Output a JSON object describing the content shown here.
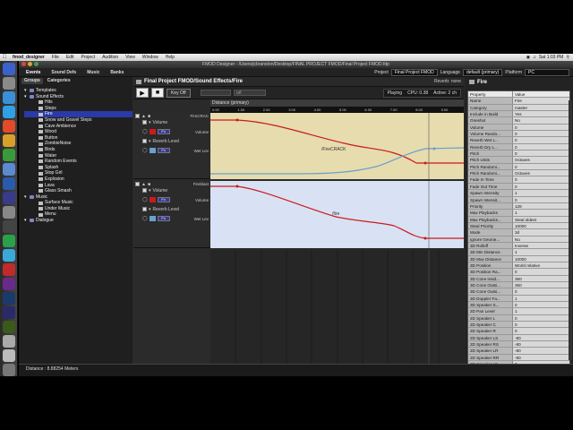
{
  "menubar": {
    "app": "fmod_designer",
    "items": [
      "File",
      "Edit",
      "Project",
      "Audition",
      "View",
      "Window",
      "Help"
    ],
    "clock": "Sat 1:03 PM"
  },
  "window": {
    "title": "FMOD Designer - /Users/jcbranston/Desktop/FINAL PROJECT FMOD/Final Project FMOD.fdp"
  },
  "toolbar": {
    "tabs": [
      "Events",
      "Sound Defs",
      "Music",
      "Banks"
    ],
    "project_label": "Project",
    "project_value": "Final Project FMOD",
    "language_label": "Language",
    "language_value": "default (primary)",
    "platform_label": "Platform",
    "platform_value": "PC"
  },
  "left": {
    "subtabs": [
      "Groups",
      "Categories"
    ],
    "tree": [
      {
        "label": "Templates",
        "type": "folder",
        "depth": 1
      },
      {
        "label": "Sound Effects",
        "type": "folder",
        "depth": 1
      },
      {
        "label": "Hits",
        "type": "event",
        "depth": 2
      },
      {
        "label": "Steps",
        "type": "event",
        "depth": 2
      },
      {
        "label": "Fire",
        "type": "event",
        "depth": 2,
        "selected": true
      },
      {
        "label": "Snow and Gravel Steps",
        "type": "event",
        "depth": 2
      },
      {
        "label": "Cave Ambience",
        "type": "event",
        "depth": 2
      },
      {
        "label": "Wood",
        "type": "event",
        "depth": 2
      },
      {
        "label": "Button",
        "type": "event",
        "depth": 2
      },
      {
        "label": "ZombieNoise",
        "type": "event",
        "depth": 2
      },
      {
        "label": "Birds",
        "type": "event",
        "depth": 2
      },
      {
        "label": "Water",
        "type": "event",
        "depth": 2
      },
      {
        "label": "Random Events",
        "type": "event",
        "depth": 2
      },
      {
        "label": "Splash",
        "type": "event",
        "depth": 2
      },
      {
        "label": "Stop Girl",
        "type": "event",
        "depth": 2
      },
      {
        "label": "Explosion",
        "type": "event",
        "depth": 2
      },
      {
        "label": "Lava",
        "type": "event",
        "depth": 2
      },
      {
        "label": "Glass Smash",
        "type": "event",
        "depth": 2
      },
      {
        "label": "Music",
        "type": "folder",
        "depth": 1
      },
      {
        "label": "Surface Music",
        "type": "event",
        "depth": 2
      },
      {
        "label": "Under Music",
        "type": "event",
        "depth": 2
      },
      {
        "label": "Menu",
        "type": "event",
        "depth": 2
      },
      {
        "label": "Dialogue",
        "type": "folder",
        "depth": 1
      }
    ]
  },
  "center": {
    "event_path": "Final Project FMOD/Sound Effects/Fire",
    "reverb": "Reverb: none",
    "key_off": "Key Off",
    "param_placeholder": "",
    "param_value": "Off",
    "playing": "Playing",
    "cpu": "CPU: 0.38",
    "active": "Active: 2 ch",
    "parameter_title": "Distance (primary)",
    "ruler_ticks": [
      "0.00",
      "1.00",
      "2.00",
      "3.00",
      "4.00",
      "5.00",
      "6.00",
      "7.00",
      "8.00",
      "9.00"
    ],
    "layers": [
      {
        "name": "FireCRAC",
        "volume_label": "Volume",
        "reverb_label": "Reverb Level",
        "volume_effect": "Volume",
        "reverb_effect": "Wet Lev",
        "sound_label": "/FireCRACK",
        "effect_btn": "Fx"
      },
      {
        "name": "Fireblast",
        "volume_label": "Volume",
        "reverb_label": "Reverb Level",
        "volume_effect": "Volume",
        "reverb_effect": "Wet Lev",
        "sound_label": "/fire",
        "effect_btn": "Fx"
      }
    ]
  },
  "right": {
    "title": "Fire",
    "columns": [
      "Property",
      "Value"
    ],
    "rows": [
      [
        "Name",
        "Fire"
      ],
      [
        "Category",
        "master"
      ],
      [
        "Include in Build",
        "Yes"
      ],
      [
        "Oneshot",
        "No"
      ],
      [
        "Volume",
        "0"
      ],
      [
        "Volume Rando...",
        "0"
      ],
      [
        "Reverb Wet L...",
        "0"
      ],
      [
        "Reverb Dry L...",
        "0"
      ],
      [
        "Pitch",
        "0"
      ],
      [
        "Pitch Units",
        "Octaves"
      ],
      [
        "Pitch Randomi...",
        "0"
      ],
      [
        "Pitch Randomi...",
        "Octaves"
      ],
      [
        "Fade In Time",
        "0"
      ],
      [
        "Fade Out Time",
        "0"
      ],
      [
        "Spawn Intensity",
        "1"
      ],
      [
        "Spawn Intensit...",
        "0"
      ],
      [
        "Priority",
        "128"
      ],
      [
        "Max Playbacks",
        "1"
      ],
      [
        "Max Playbacks...",
        "Steal oldest"
      ],
      [
        "Steal Priority",
        "10000"
      ],
      [
        "Mode",
        "3d"
      ],
      [
        "Ignore Geome...",
        "No"
      ],
      [
        "3D Rolloff",
        "Inverse"
      ],
      [
        "3D Min Distance",
        "1"
      ],
      [
        "3D Max Distance",
        "10000"
      ],
      [
        "3D Position",
        "World relative"
      ],
      [
        "3D Position Ra...",
        "0"
      ],
      [
        "3D Cone Insid...",
        "360"
      ],
      [
        "3D Cone Outsi...",
        "360"
      ],
      [
        "3D Cone Outsi...",
        "0"
      ],
      [
        "3D Doppler Fa...",
        "1"
      ],
      [
        "3D Speaker S...",
        "0"
      ],
      [
        "2D Pan Level",
        "1"
      ],
      [
        "2D Speaker L",
        "0"
      ],
      [
        "2D Speaker C",
        "0"
      ],
      [
        "2D Speaker R",
        "0"
      ],
      [
        "2D Speaker LS",
        "-80"
      ],
      [
        "2D Speaker RS",
        "-80"
      ],
      [
        "2D Speaker LR",
        "-80"
      ],
      [
        "2D Speaker RR",
        "-80"
      ],
      [
        "2D Speaker LF",
        "0"
      ]
    ]
  },
  "status": {
    "text": "Distance : 8.88254 Meters"
  },
  "colors": {
    "layer1_bg": "#e6dcae",
    "layer2_bg": "#d8e2f4",
    "volume_curve": "#cc1a1a",
    "reverb_curve": "#6b9fd0",
    "selection": "#2a3aa6"
  }
}
